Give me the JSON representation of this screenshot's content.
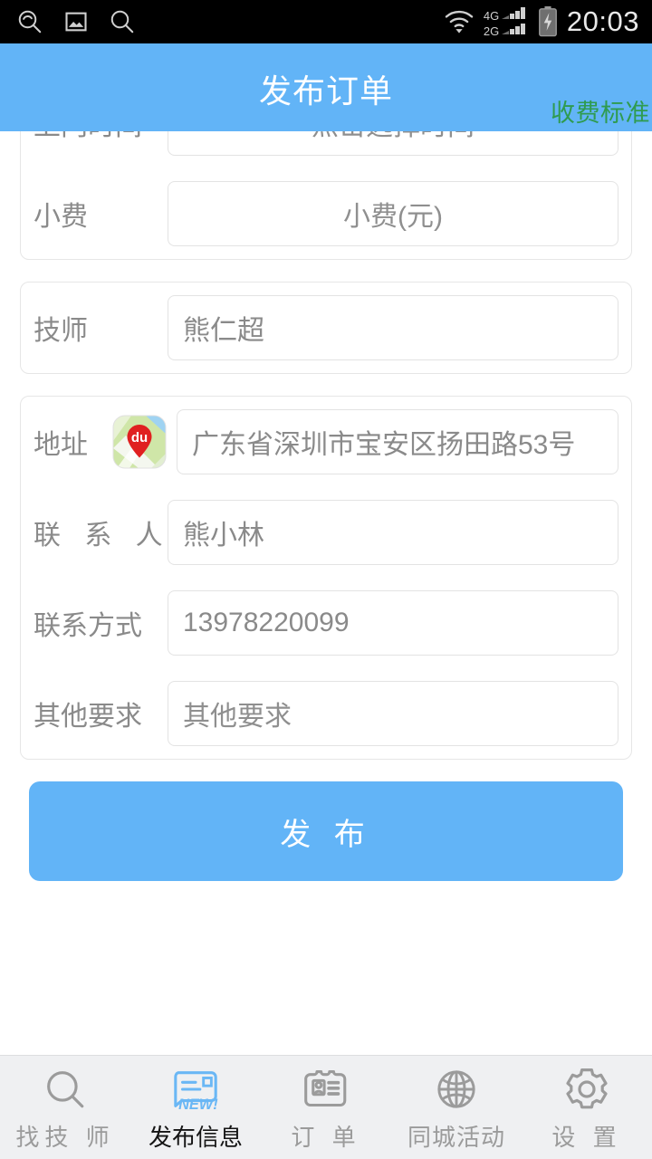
{
  "statusbar": {
    "icons": [
      "search-history-icon",
      "gallery-icon",
      "search-icon"
    ],
    "wifi": "wifi-icon",
    "sim1_label": "4G",
    "sim2_label": "2G",
    "battery": "battery-charging-icon",
    "time": "20:03"
  },
  "header": {
    "title": "发布订单",
    "action_label": "收费标准",
    "bg_color": "#62b4f7",
    "action_color": "#2f9b50"
  },
  "form": {
    "cards": [
      {
        "rows": [
          {
            "label": "上门时间",
            "placeholder": "点击选择时间",
            "value": "",
            "align": "center"
          },
          {
            "label": "小费",
            "placeholder": "小费(元)",
            "value": "",
            "align": "center"
          }
        ]
      },
      {
        "rows": [
          {
            "label": "技师",
            "placeholder": "",
            "value": "熊仁超",
            "align": "left"
          }
        ]
      },
      {
        "rows": [
          {
            "label": "地址",
            "icon": "baidu-map-icon",
            "placeholder": "",
            "value": "广东省深圳市宝安区扬田路53号",
            "align": "left"
          },
          {
            "label": "联 系 人",
            "placeholder": "",
            "value": "熊小林",
            "align": "left"
          },
          {
            "label": "联系方式",
            "placeholder": "",
            "value": "13978220099",
            "align": "left"
          },
          {
            "label": "其他要求",
            "placeholder": "其他要求",
            "value": "",
            "align": "left"
          }
        ]
      }
    ],
    "submit_label": "发 布",
    "submit_color": "#62b4f7"
  },
  "bottomnav": {
    "items": [
      {
        "label": "找技 师",
        "icon": "search-icon",
        "active": false
      },
      {
        "label": "发布信息",
        "icon": "new-post-icon",
        "active": true
      },
      {
        "label": "订 单",
        "icon": "id-card-icon",
        "active": false
      },
      {
        "label": "同城活动",
        "icon": "globe-icon",
        "active": false
      },
      {
        "label": "设 置",
        "icon": "gear-icon",
        "active": false
      }
    ],
    "active_color": "#6ab7f5"
  }
}
